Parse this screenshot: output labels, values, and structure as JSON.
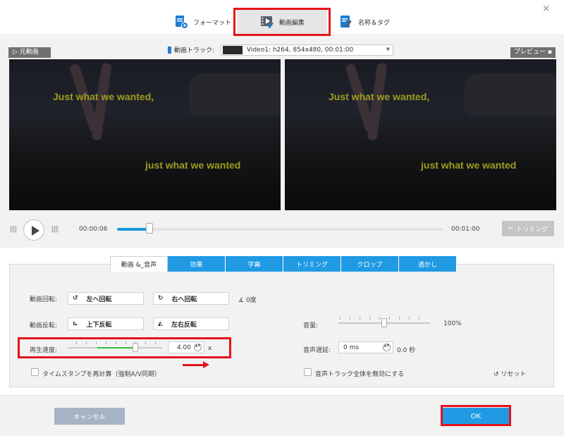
{
  "window": {
    "close_glyph": "×"
  },
  "tabs": [
    {
      "label": "フォーマット",
      "icon": "format-icon"
    },
    {
      "label": "動画編集",
      "icon": "video-edit-icon",
      "active": true
    },
    {
      "label": "名称＆タグ",
      "icon": "name-tag-icon"
    }
  ],
  "video": {
    "source_label": "元動画",
    "preview_label": "プレビュー",
    "track_label": "動画トラック:",
    "track_value": "Video1: h264, 854x480, 00:01:00",
    "subtitle_top": "Just what we wanted,",
    "subtitle_bottom": "just what we wanted"
  },
  "playback": {
    "current_time": "00:00:06",
    "total_time": "00:01:00",
    "progress": 0.1,
    "trim_label": "トリミング"
  },
  "edit_tabs": [
    {
      "label": "動画 &_音声",
      "active": true
    },
    {
      "label": "効果"
    },
    {
      "label": "字幕"
    },
    {
      "label": "トリミング"
    },
    {
      "label": "クロップ"
    },
    {
      "label": "透かし"
    }
  ],
  "rotation": {
    "label": "動画回転:",
    "rotate_left": "左へ回転",
    "rotate_right": "右へ回転",
    "angle": "0度"
  },
  "flip": {
    "label": "動画反転:",
    "vertical": "上下反転",
    "horizontal": "左右反転"
  },
  "speed": {
    "label": "再生速度:",
    "value": "4.00",
    "unit": "x",
    "slider_fraction": 0.72
  },
  "timestamp": {
    "label": "タイムスタンプを再計算（強制A/V同期）",
    "checked": false
  },
  "volume": {
    "label": "音量:",
    "value": "100%",
    "slider_fraction": 0.5
  },
  "audio_delay": {
    "label": "音声遅延:",
    "value": "0 ms",
    "seconds": "0.0 秒"
  },
  "disable_audio": {
    "label": "音声トラック全体を無効にする",
    "checked": false
  },
  "reset_label": "リセット",
  "footer": {
    "cancel_label": "キャンセル",
    "ok_label": "OK"
  },
  "colors": {
    "accent": "#1f9ae3",
    "highlight": "#e4141b",
    "cancel_bg": "#a6b3c4"
  }
}
